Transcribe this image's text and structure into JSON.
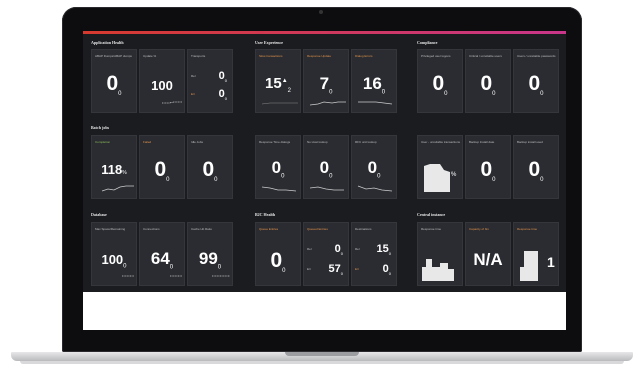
{
  "colors": {
    "accent_start": "#d63a2e",
    "accent_end": "#c9368a",
    "panel": "#2a2c31",
    "background": "#1b1c20",
    "label_highlight": "#e2924a"
  },
  "sections": {
    "app_health": "Application Health",
    "user_experience": "User Experience",
    "compliance": "Compliance",
    "batch_jobs": "Batch jobs",
    "database": "Database",
    "b2c_health": "B2C Health",
    "central_instance": "Central instance"
  },
  "tiles": {
    "t1": {
      "label": "ABAP Dumps/ABAP dumps",
      "value": "0"
    },
    "t2": {
      "label": "Update %",
      "value": "100"
    },
    "t3": {
      "label": "Transports",
      "top_value": "0",
      "bottom_value": "0"
    },
    "t4": {
      "label": "Slow transactions",
      "value": "15",
      "sub": "2"
    },
    "t5": {
      "label": "Response Update",
      "value": "7"
    },
    "t6": {
      "label": "Dialog Errors",
      "value": "16"
    },
    "t7": {
      "label": "Privileged user logons",
      "value": "0"
    },
    "t8": {
      "label": "Critical / unreliable users",
      "value": "0"
    },
    "t9": {
      "label": "Users / unreliable passwords",
      "value": "0"
    },
    "t10": {
      "label": "Completion",
      "value": "118",
      "unit": "%"
    },
    "t11": {
      "label": "Failed",
      "value": "0"
    },
    "t12": {
      "label": "Idle Jobs",
      "value": "0"
    },
    "t13": {
      "label": "Response Time dialogs",
      "value": "0"
    },
    "t14": {
      "label": "No Host lookup",
      "value": "0"
    },
    "t15": {
      "label": "RFC unit lookup",
      "value": "0"
    },
    "t16": {
      "label": "User - unreliable transactions",
      "value": "%"
    },
    "t17": {
      "label": "Backup Install date",
      "value": "0"
    },
    "t18": {
      "label": "Backup install used",
      "value": "0"
    },
    "t19": {
      "label": "Max Space/Remaining",
      "value": "100"
    },
    "t20": {
      "label": "Connections",
      "value": "64"
    },
    "t21": {
      "label": "Cache Hit Ratio",
      "value": "99"
    },
    "t22": {
      "label": "Queue Entries",
      "value": "0"
    },
    "t23": {
      "label": "Queued Entries",
      "top_value": "0",
      "bottom_value": "57"
    },
    "t24": {
      "label": "Destinations",
      "top_value": "15",
      "bottom_value": "0"
    },
    "t25": {
      "label": "Response time",
      "value": ""
    },
    "t26": {
      "label": "Capacity of bin",
      "value": "N/A"
    },
    "t27": {
      "label": "Response time",
      "value": "1"
    }
  }
}
